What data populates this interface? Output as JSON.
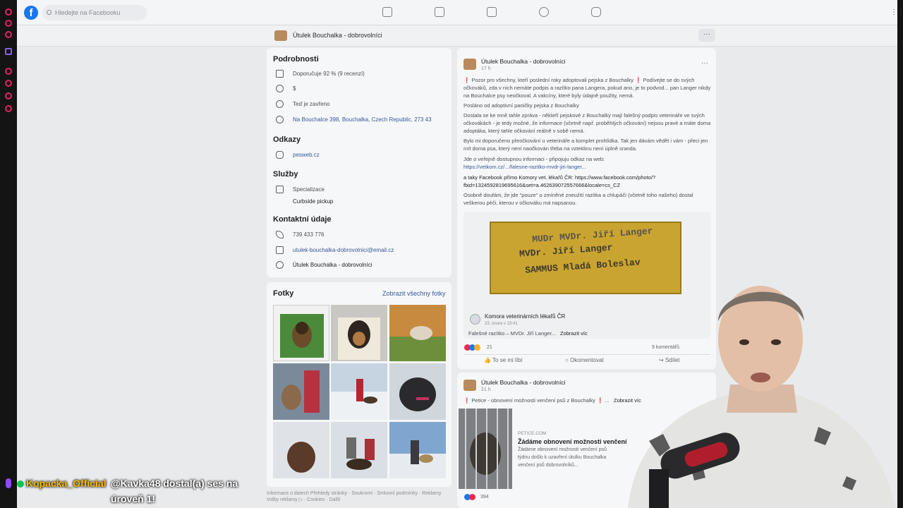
{
  "topbar": {
    "search_placeholder": "Hledejte na Facebooku"
  },
  "page": {
    "name": "Útulek Bouchalka - dobrovolníci",
    "more": "···"
  },
  "details": {
    "heading": "Podrobnosti",
    "recommend": "Doporučuje 92 % (9 recenzí)",
    "price": "$",
    "status": "Teď je zavřeno",
    "address": "Na Bouchalce 398, Bouchalka, Czech Republic, 273 43"
  },
  "links": {
    "heading": "Odkazy",
    "web": "pesweb.cz"
  },
  "services": {
    "heading": "Služby",
    "item1": "Specializace",
    "item2": "Curbside pickup"
  },
  "contact": {
    "heading": "Kontaktní údaje",
    "phone": "739 433 776",
    "email": "utulek-bouchalka-dobrovolnici@email.cz",
    "messenger": "Útulek Bouchalka - dobrovolníci"
  },
  "photos": {
    "heading": "Fotky",
    "show_all": "Zobrazit všechny fotky"
  },
  "footer": {
    "line1": "Informace o datech Přehledy stránky · Soukromí · Smluvní podmínky · Reklamy",
    "line2": "Volby reklamy ▷ · Cookies · Další"
  },
  "post1": {
    "author": "Útulek Bouchalka - dobrovolníci",
    "time": "17 h",
    "p1": "❗ Pozor pro všechny, kteří poslední roky adoptovali pejska z Bouchalky ❗ Podívejte se do svých očkováků, zda v nich nemáte podpis a razítko pana Langera, pokud ano, je to podvod... pan Langer nikdy na Bouchalce psy neočkoval. A vakcíny, které byly údajně použity, nemá.",
    "p2": "Posláno od adoptivní paničky pejska z Bouchalky",
    "p3": "Dostala se ke mně tahle zpráva - někteří pejskové z Bouchalky mají falešný podpis veterináře ve svých očkovákách - je tedy možné, že informace (včetně např. proběhlých očkování) nejsou pravé a máte doma adoptáka, který tahle očkování reálně v sobě nemá.",
    "p4": "Bylo mi doporučeno přeočkování u veterináře a komplet prohlídka. Tak jen dávám vědět i vám - přeci jen mít doma psa, který není naočkován třeba na vzteklinu není úplně sranda.",
    "p5": "Jde o veřejně dostupnou informaci - připojuju odkaz na web:",
    "p5link": "https://vetkom.cz/.../falesne-razitko-mvdr-jiri-langer...",
    "p6": "a taky Facebook přímo Komory vet. lékařů ČR: https://www.facebook.com/photo/?fbid=1324592819695616&set=a.462639072557666&locale=cs_CZ",
    "p7": "Osobně doufám, že jde \"pouze\" o zmíněné zneužití razítka a chlupáči (včetně toho našeho) dostal veškerou péči, kterou v očkováku má napsanou.",
    "stamp1": "MUDr MVDr. Jiří Langer",
    "stamp2": "MVDr. Jiří Langer",
    "stamp3": "SAMMUS Mladá Boleslav",
    "shared_author": "Komora veterinárních lékařů ČR",
    "shared_time": "23. února v 13:41",
    "shared_text": "Falešné razítko – MVDr. Jiří Langer...",
    "shared_more": "Zobrazit víc",
    "reactions": "21",
    "comments": "9 komentářů",
    "like": "To se mi líbí",
    "comment": "Okomentovat",
    "share": "Sdílet"
  },
  "post2": {
    "author": "Útulek Bouchalka - dobrovolníci",
    "time": "21 h",
    "text": "❗ Petice - obnovení možnosti venčení psů z Bouchalky ❗ ...",
    "more": "Zobrazit víc",
    "link_domain": "PETICE.COM",
    "link_title": "Žádáme obnovení možnosti venčení",
    "link_desc1": "Žádáme obnovení možnosti venčení psů",
    "link_desc2": "týdnu došlo k uzavření útulku Bouchalka",
    "link_desc3": "venčení psů dobrovolníků...",
    "reactions": "394"
  },
  "stream": {
    "user": "Kopacka_Official",
    "msg1": "@Kavka48 dostal(a) ses na",
    "msg2": "úroveň 1!"
  }
}
